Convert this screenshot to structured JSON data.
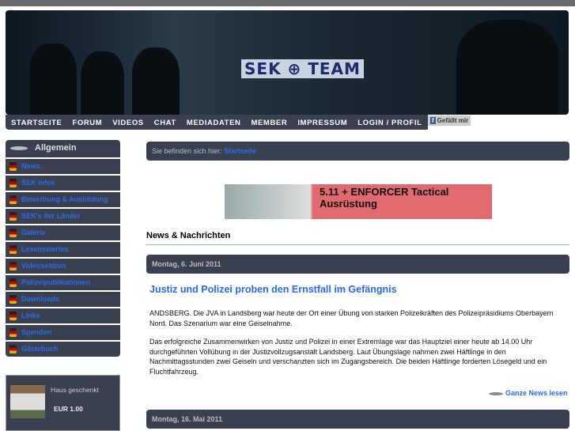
{
  "header": {
    "logo": "SEK ⊕ TEAM"
  },
  "nav": [
    "STARTSEITE",
    "FORUM",
    "VIDEOS",
    "CHAT",
    "MEDIADATEN",
    "MEMBER",
    "IMPRESSUM",
    "LOGIN / PROFIL"
  ],
  "like": {
    "icon": "f",
    "label": "Gefällt mir"
  },
  "sidebar": {
    "title": "Allgemein",
    "items": [
      "News",
      "SEK Infos",
      "Bewerbung & Ausbildung",
      "SEK's der Länder",
      "Galerie",
      "Lesenswertes",
      "Videosektion",
      "Polizeipublikationen",
      "Downloads",
      "Links",
      "Spenden",
      "Gästebuch"
    ]
  },
  "donation": {
    "label": "Haus geschenkt",
    "amount": "EUR 1.00"
  },
  "breadcrumb": {
    "prefix": "Sie befinden sich hier:",
    "current": "Startseite"
  },
  "ad": {
    "text": "5.11 + ENFORCER Tactical Ausrüstung"
  },
  "section_title": "News & Nachrichten",
  "posts": [
    {
      "date": "Montag, 6. Juni 2011",
      "title": "Justiz und Polizei proben den Ernstfall im Gefängnis",
      "paragraphs": [
        "ANDSBERG. Die JVA in Landsberg war heute der Ort einer Übung von starken Polizeikräften des Polizeipräsidiums Oberbayern Nord. Das Szenarium war eine Geiselnahme.",
        "Das erfolgreiche Zusammenwirken von Justiz und Polizei in einer Extremlage war das Hauptziel einer heute ab 14.00 Uhr durchgeführten Vollübung in der Justizvollzugsanstalt Landsberg. Laut Übungslage nahmen zwei Häftlinge in den Nachmittagsstunden zwei Geiseln und verschanzten sich im Zugangsbereich. Die beiden Häftlinge forderten Lösegeld und ein Fluchtfahrzeug."
      ],
      "more": "Ganze News lesen"
    },
    {
      "date": "Montag, 16. Mai 2011"
    }
  ]
}
